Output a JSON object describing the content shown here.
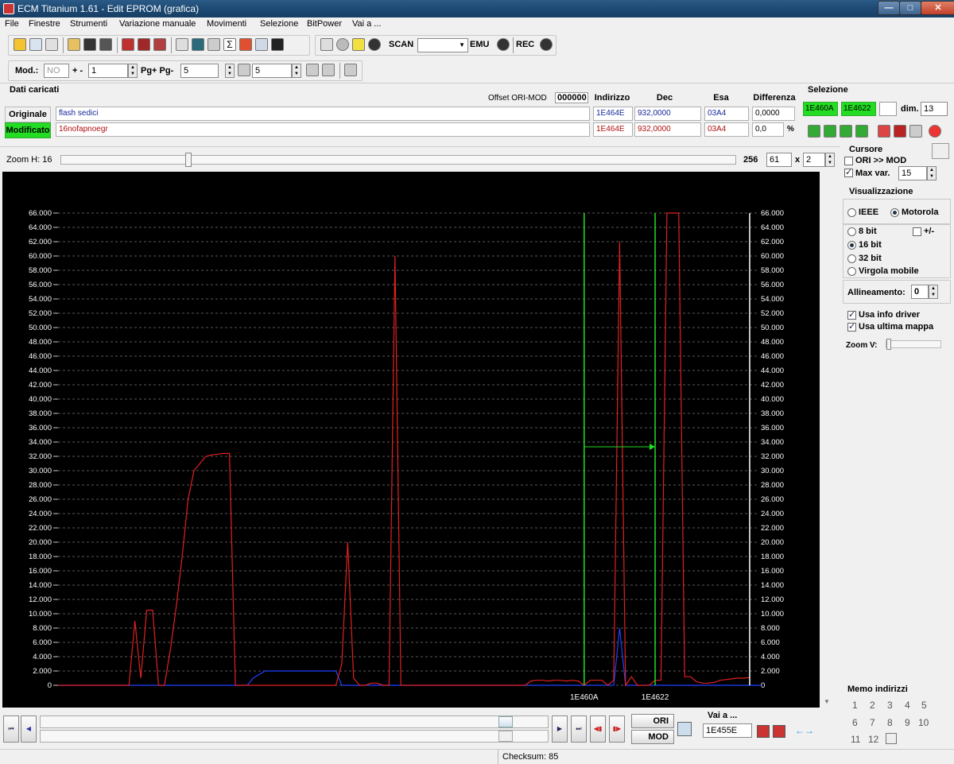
{
  "window": {
    "title": "ECM Titanium 1.61 - Edit EPROM (grafica)",
    "minimize": "—",
    "maximize": "□",
    "close": "✕"
  },
  "menu": [
    "File",
    "Finestre",
    "Strumenti",
    "Variazione manuale",
    "Movimenti",
    "Selezione",
    "BitPower",
    "Vai a ..."
  ],
  "toolbar1": {
    "scan_label": "SCAN",
    "emu_label": "EMU",
    "rec_label": "REC"
  },
  "toolbar2": {
    "mod_label": "Mod.:",
    "mod_value": "NO",
    "step_label": "+ -",
    "step_value": "1",
    "page_label": "Pg+ Pg-",
    "page_value": "5",
    "p_value": "5"
  },
  "dati": {
    "title": "Dati caricati",
    "offset_label": "Offset ORI-MOD",
    "offset_value": "000000",
    "col_indirizzo": "Indirizzo",
    "col_dec": "Dec",
    "col_esa": "Esa",
    "col_diff": "Differenza",
    "originale": {
      "label": "Originale",
      "name": "flash sedici",
      "indirizzo": "1E464E",
      "dec": "932,0000",
      "esa": "03A4",
      "diff": "0,0000"
    },
    "modificato": {
      "label": "Modificato",
      "name": "16nofapnoegr",
      "indirizzo": "1E464E",
      "dec": "932,0000",
      "esa": "03A4",
      "diff": "0,0",
      "pct": "%"
    }
  },
  "selezione": {
    "title": "Selezione",
    "start": "1E460A",
    "end": "1E4622",
    "dim_label": "dim.",
    "dim_value": "13"
  },
  "zoom": {
    "label": "Zoom H: 16",
    "max": "256",
    "value": "61",
    "x_label": "x",
    "factor": "2"
  },
  "cursore": {
    "title": "Cursore",
    "ori_mod_label": "ORI >> MOD",
    "max_var_label": "Max var.",
    "max_var_value": "15"
  },
  "visualizzazione": {
    "title": "Visualizzazione",
    "ieee": "IEEE",
    "motorola": "Motorola",
    "b8": "8 bit",
    "pm": "+/-",
    "b16": "16 bit",
    "b32": "32 bit",
    "virgola": "Virgola mobile",
    "allineamento_label": "Allineamento:",
    "allineamento_value": "0",
    "usa_info": "Usa info driver",
    "usa_mappa": "Usa ultima mappa",
    "zoomv": "Zoom V:"
  },
  "memo": {
    "title": "Memo indirizzi",
    "items": [
      "1",
      "2",
      "3",
      "4",
      "5",
      "6",
      "7",
      "8",
      "9",
      "10",
      "11",
      "12"
    ]
  },
  "bottom": {
    "ori_label": "ORI",
    "mod_label": "MOD",
    "vaia_label": "Vai a ...",
    "vaia_value": "1E455E"
  },
  "status": {
    "checksum": "Checksum: 85"
  },
  "colors": {
    "plot_bg": "#000000",
    "red_series": "#e02020",
    "blue_series": "#2040ff",
    "selection_line": "#22dd22",
    "cursor": "#ffffff"
  },
  "chart_data": {
    "type": "line",
    "ylim": [
      0,
      66000
    ],
    "yticks": [
      "0",
      "2.000",
      "4.000",
      "6.000",
      "8.000",
      "10.000",
      "12.000",
      "14.000",
      "16.000",
      "18.000",
      "20.000",
      "22.000",
      "24.000",
      "26.000",
      "28.000",
      "30.000",
      "32.000",
      "34.000",
      "36.000",
      "38.000",
      "40.000",
      "42.000",
      "44.000",
      "46.000",
      "48.000",
      "50.000",
      "52.000",
      "54.000",
      "56.000",
      "58.000",
      "60.000",
      "62.000",
      "64.000",
      "66.000"
    ],
    "x_labels": [
      {
        "text": "1E460A",
        "index": 61
      },
      {
        "text": "1E4622",
        "index": 73
      }
    ],
    "series": [
      {
        "values": [
          0,
          0,
          0,
          0,
          0,
          0,
          0,
          0,
          0,
          0,
          0,
          0,
          0,
          9000,
          1000,
          10500,
          10500,
          0,
          0,
          5000,
          11000,
          18000,
          26000,
          30000,
          31000,
          32000,
          32200,
          32300,
          32400,
          32400,
          0,
          0,
          0,
          0,
          0,
          0,
          0,
          0,
          0,
          0,
          0,
          0,
          0,
          0,
          0,
          0,
          0,
          0,
          3000,
          20000,
          1000,
          0,
          0,
          300,
          300,
          0,
          0,
          60000,
          0,
          0,
          0,
          0,
          0,
          0,
          0,
          0,
          0,
          0,
          0,
          0,
          0,
          0,
          0,
          0,
          0,
          0,
          0,
          0,
          0,
          0,
          600,
          700,
          700,
          600,
          700,
          700,
          600,
          700,
          600,
          0,
          700,
          700,
          700,
          0,
          700,
          62000,
          0,
          1200,
          0,
          0,
          0,
          700,
          700,
          66000,
          66000,
          66000,
          1200,
          1200,
          500,
          300,
          300,
          400,
          700,
          800,
          900,
          1000,
          1000,
          1100
        ]
      },
      {
        "values": [
          0,
          0,
          0,
          0,
          0,
          0,
          0,
          0,
          0,
          0,
          0,
          0,
          0,
          0,
          0,
          0,
          0,
          0,
          0,
          0,
          0,
          0,
          0,
          0,
          0,
          0,
          0,
          0,
          0,
          0,
          0,
          0,
          0,
          1000,
          1500,
          2000,
          2000,
          2000,
          2000,
          2000,
          2000,
          2000,
          2000,
          2000,
          2000,
          2000,
          2000,
          2000,
          0,
          0,
          0,
          0,
          0,
          0,
          0,
          0,
          0,
          0,
          0,
          0,
          0,
          0,
          0,
          0,
          0,
          0,
          0,
          0,
          0,
          0,
          0,
          0,
          0,
          0,
          0,
          0,
          0,
          0,
          0,
          0,
          0,
          0,
          0,
          0,
          0,
          0,
          0,
          0,
          0,
          0,
          0,
          0,
          0,
          0,
          0,
          8000,
          0,
          0,
          0,
          0,
          0,
          0,
          0,
          0,
          0,
          0,
          0,
          0,
          0,
          0,
          0,
          0,
          0,
          0,
          0,
          0,
          0,
          0,
          0,
          0
        ]
      }
    ],
    "selection_start_index": 89,
    "selection_end_index": 101,
    "cursor_index": 117
  }
}
